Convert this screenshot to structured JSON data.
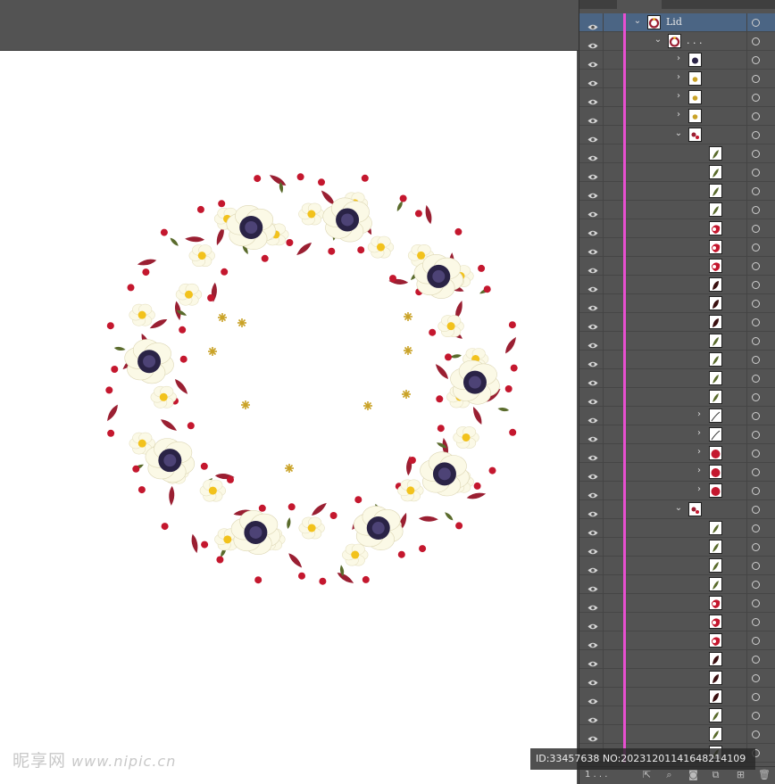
{
  "watermark": {
    "brand": "昵享网",
    "url": "www.nipic.cn"
  },
  "id_bar": {
    "text": "ID:33457638 NO:20231201141648214109"
  },
  "layers_panel": {
    "top_layer_name": "Lid",
    "group_name": ". . .",
    "footer_count": "1 . . .",
    "highlight_color": "#e84fd0",
    "rows": [
      {
        "indent": 0,
        "toggle": "expanded",
        "thumb": "wreath",
        "name": "Lid",
        "selected": true
      },
      {
        "indent": 1,
        "toggle": "expanded",
        "thumb": "wreath",
        "name": ". . ."
      },
      {
        "indent": 2,
        "toggle": "collapsed",
        "thumb": "dark-flower"
      },
      {
        "indent": 2,
        "toggle": "collapsed",
        "thumb": "gold-flake"
      },
      {
        "indent": 2,
        "toggle": "collapsed",
        "thumb": "gold-flake"
      },
      {
        "indent": 2,
        "toggle": "collapsed",
        "thumb": "gold-flake"
      },
      {
        "indent": 2,
        "toggle": "expanded",
        "thumb": "flower-cluster"
      },
      {
        "indent": 3,
        "thumb": "leaf-green"
      },
      {
        "indent": 3,
        "thumb": "leaf-green"
      },
      {
        "indent": 3,
        "thumb": "leaf-green"
      },
      {
        "indent": 3,
        "thumb": "leaf-green"
      },
      {
        "indent": 3,
        "thumb": "red-petal"
      },
      {
        "indent": 3,
        "thumb": "red-petal"
      },
      {
        "indent": 3,
        "thumb": "red-petal"
      },
      {
        "indent": 3,
        "thumb": "dark-leaf"
      },
      {
        "indent": 3,
        "thumb": "dark-leaf"
      },
      {
        "indent": 3,
        "thumb": "dark-leaf"
      },
      {
        "indent": 3,
        "thumb": "leaf-green"
      },
      {
        "indent": 3,
        "thumb": "leaf-green"
      },
      {
        "indent": 3,
        "thumb": "leaf-green"
      },
      {
        "indent": 3,
        "thumb": "leaf-green"
      },
      {
        "indent": 3,
        "toggle": "collapsed",
        "thumb": "stem"
      },
      {
        "indent": 3,
        "toggle": "collapsed",
        "thumb": "stem"
      },
      {
        "indent": 3,
        "toggle": "collapsed",
        "thumb": "red-berry"
      },
      {
        "indent": 3,
        "toggle": "collapsed",
        "thumb": "red-berry"
      },
      {
        "indent": 3,
        "toggle": "collapsed",
        "thumb": "red-berry"
      },
      {
        "indent": 2,
        "toggle": "expanded",
        "thumb": "flower-cluster"
      },
      {
        "indent": 3,
        "thumb": "leaf-green"
      },
      {
        "indent": 3,
        "thumb": "leaf-green"
      },
      {
        "indent": 3,
        "thumb": "leaf-green"
      },
      {
        "indent": 3,
        "thumb": "leaf-green"
      },
      {
        "indent": 3,
        "thumb": "red-petal"
      },
      {
        "indent": 3,
        "thumb": "red-petal"
      },
      {
        "indent": 3,
        "thumb": "red-petal"
      },
      {
        "indent": 3,
        "thumb": "dark-leaf"
      },
      {
        "indent": 3,
        "thumb": "dark-leaf"
      },
      {
        "indent": 3,
        "thumb": "dark-leaf"
      },
      {
        "indent": 3,
        "thumb": "leaf-green"
      },
      {
        "indent": 3,
        "thumb": "leaf-green"
      },
      {
        "indent": 3,
        "thumb": "leaf-green"
      }
    ]
  },
  "colors": {
    "flower_white": "#fbf9e6",
    "flower_center": "#f2c21c",
    "anemone_center": "#2a2346",
    "leaf_crimson": "#9a1f32",
    "berry_red": "#c4172e",
    "gold_flake": "#c9a227",
    "leaf_green": "#5a6b2c"
  }
}
